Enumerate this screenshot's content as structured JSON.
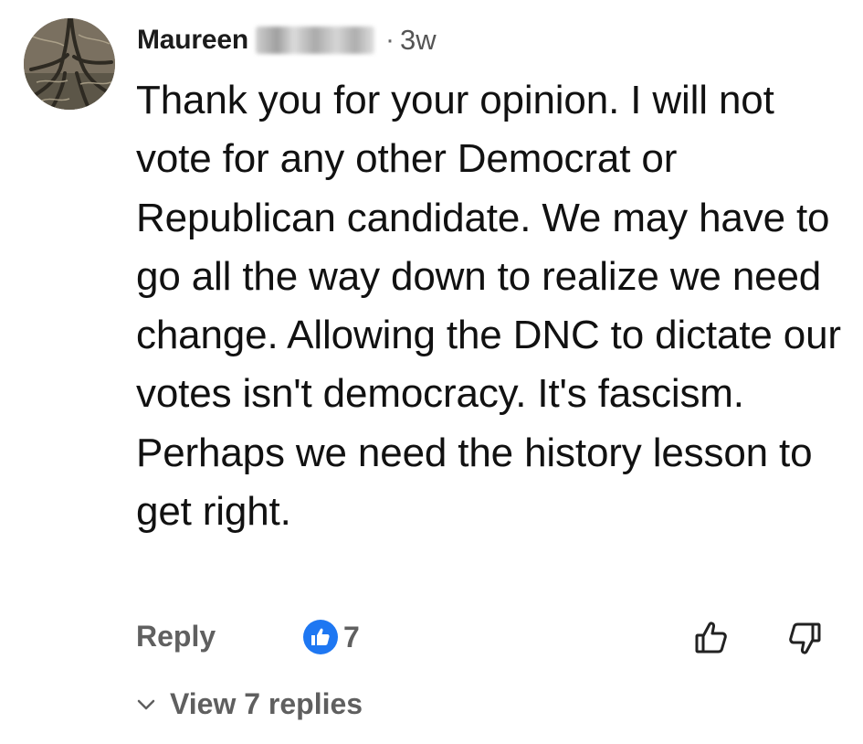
{
  "comment": {
    "author": "Maureen",
    "separator": "·",
    "time": "3w",
    "text": "Thank you for your opinion. I will not vote for any other Democrat or Republican candidate. We may have to go all the way down to realize we need change. Allowing the DNC to dictate our votes isn't democracy. It's fascism. Perhaps we need the history lesson to get right."
  },
  "actions": {
    "reply_label": "Reply",
    "like_count": "7",
    "view_replies_label": "View 7 replies"
  },
  "icons": {
    "avatar": "tree-roots-avatar",
    "like_badge": "thumbs-up-badge-icon",
    "like_button": "thumbs-up-outline-icon",
    "dislike_button": "thumbs-down-outline-icon",
    "expand": "chevron-down-icon"
  },
  "colors": {
    "like_badge": "#1e77f2",
    "action_text": "#606060",
    "body_text": "#111111"
  }
}
